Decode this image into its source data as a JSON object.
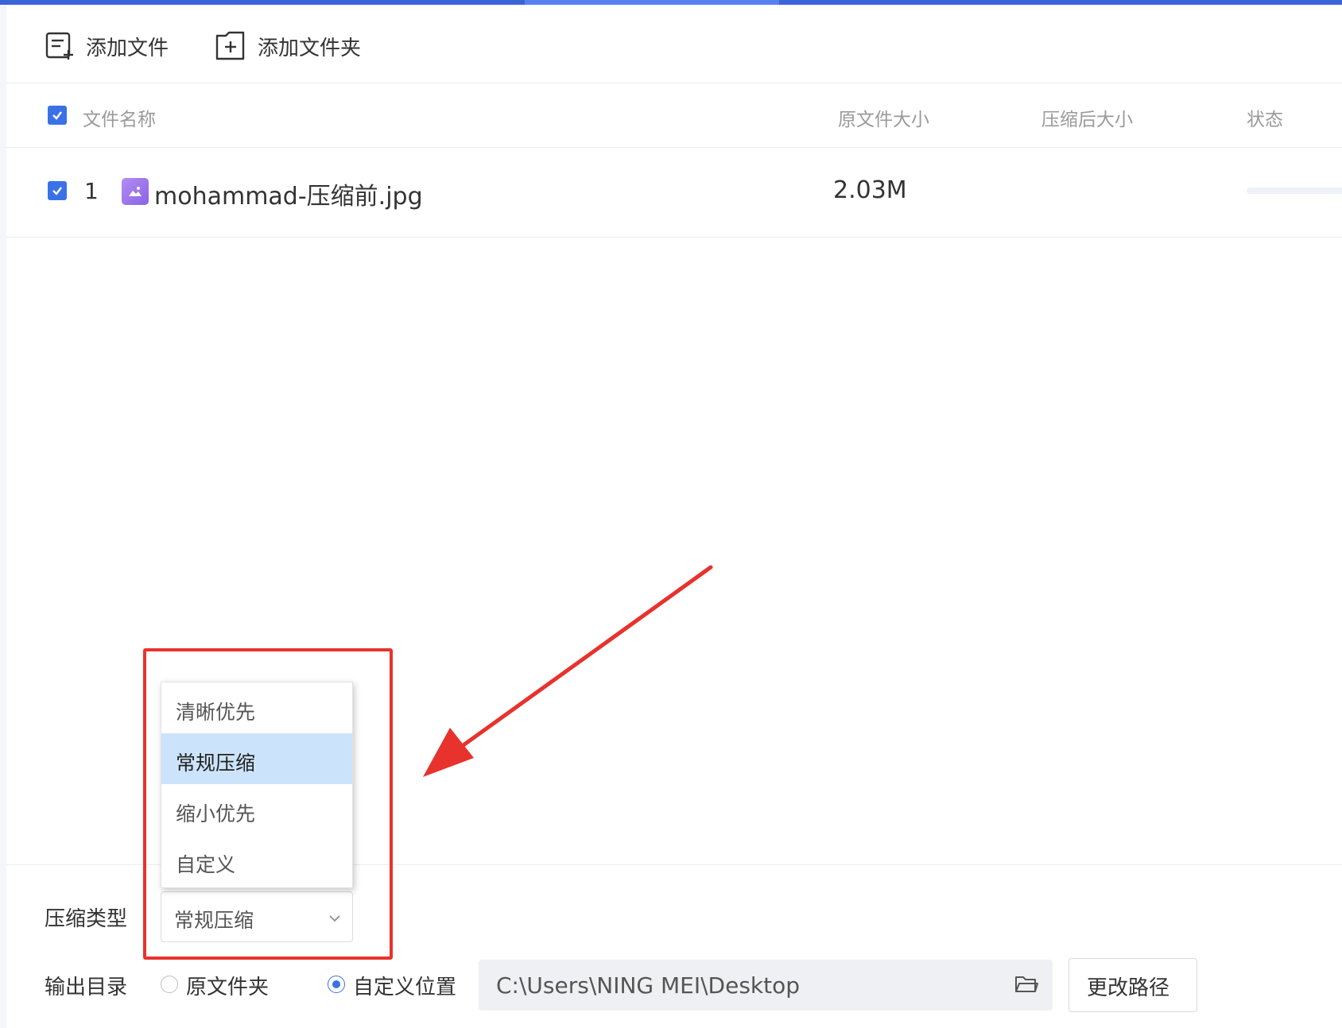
{
  "toolbar": {
    "add_file": "添加文件",
    "add_folder": "添加文件夹"
  },
  "table": {
    "headers": {
      "name": "文件名称",
      "original_size": "原文件大小",
      "compressed_size": "压缩后大小",
      "status": "状态"
    },
    "rows": [
      {
        "index": "1",
        "name": "mohammad-压缩前.jpg",
        "original_size": "2.03M",
        "compressed_size": "",
        "status": ""
      }
    ]
  },
  "settings": {
    "compress_type_label": "压缩类型",
    "compress_type_value": "常规压缩",
    "compress_options": [
      "清晰优先",
      "常规压缩",
      "缩小优先",
      "自定义"
    ],
    "selected_option": "常规压缩",
    "output_dir_label": "输出目录",
    "output_options": [
      "原文件夹",
      "自定义位置"
    ],
    "output_selected": "自定义位置",
    "path": "C:\\Users\\NING MEI\\Desktop",
    "change_path": "更改路径"
  },
  "colors": {
    "accent": "#3a71e6",
    "selected_option_bg": "#cce4fb",
    "annotation": "#e8322c"
  }
}
